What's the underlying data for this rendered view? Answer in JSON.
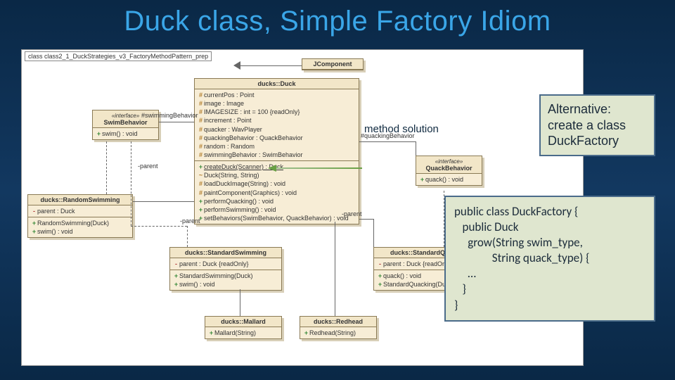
{
  "title": "Duck class, Simple Factory Idiom",
  "package_label": "class class2_1_DuckStrategies_v3_FactoryMethodPattern_prep",
  "method_solution_label": "method solution",
  "alternative": {
    "line1": "Alternative:",
    "line2": "create a class",
    "line3": "DuckFactory"
  },
  "code": "public class DuckFactory {\n   public Duck\n     grow(String swim_type,\n              String quack_type) {\n     …\n   }\n}",
  "uml": {
    "jcomponent": "JComponent",
    "duck": {
      "name": "ducks::Duck",
      "attrs": [
        "currentPos : Point",
        "image : Image",
        "IMAGESIZE : int = 100 {readOnly}",
        "increment : Point",
        "quacker : WavPlayer",
        "quackingBehavior : QuackBehavior",
        "random : Random",
        "swimmingBehavior : SwimBehavior"
      ],
      "ops": [
        "createDuck(Scanner) : Duck",
        "Duck(String, String)",
        "loadDuckImage(String) : void",
        "paintComponent(Graphics) : void",
        "performQuacking() : void",
        "performSwimming() : void",
        "setBehaviors(SwimBehavior, QuackBehavior) : void"
      ]
    },
    "swim_if": {
      "stereo": "«interface»",
      "name": "SwimBehavior",
      "ops": [
        "swim() : void"
      ]
    },
    "quack_if": {
      "stereo": "«interface»",
      "name": "QuackBehavior",
      "ops": [
        "quack() : void"
      ]
    },
    "random_swim": {
      "name": "ducks::RandomSwimming",
      "attrs": [
        "parent : Duck"
      ],
      "ops": [
        "RandomSwimming(Duck)",
        "swim() : void"
      ]
    },
    "standard_swim": {
      "name": "ducks::StandardSwimming",
      "attrs": [
        "parent : Duck {readOnly}"
      ],
      "ops": [
        "StandardSwimming(Duck)",
        "swim() : void"
      ]
    },
    "standard_quack": {
      "name": "ducks::StandardQuacking",
      "attrs": [
        "parent : Duck {readOnly}"
      ],
      "ops": [
        "quack() : void",
        "StandardQuacking(Duck)"
      ]
    },
    "mallard": {
      "name": "ducks::Mallard",
      "ops": [
        "Mallard(String)"
      ]
    },
    "redhead": {
      "name": "ducks::Redhead",
      "ops": [
        "Redhead(String)"
      ]
    }
  },
  "edge_labels": {
    "swimBehavior": "#swimmingBehavior",
    "quackBehavior": "#quackingBehavior",
    "parent": "-parent"
  }
}
